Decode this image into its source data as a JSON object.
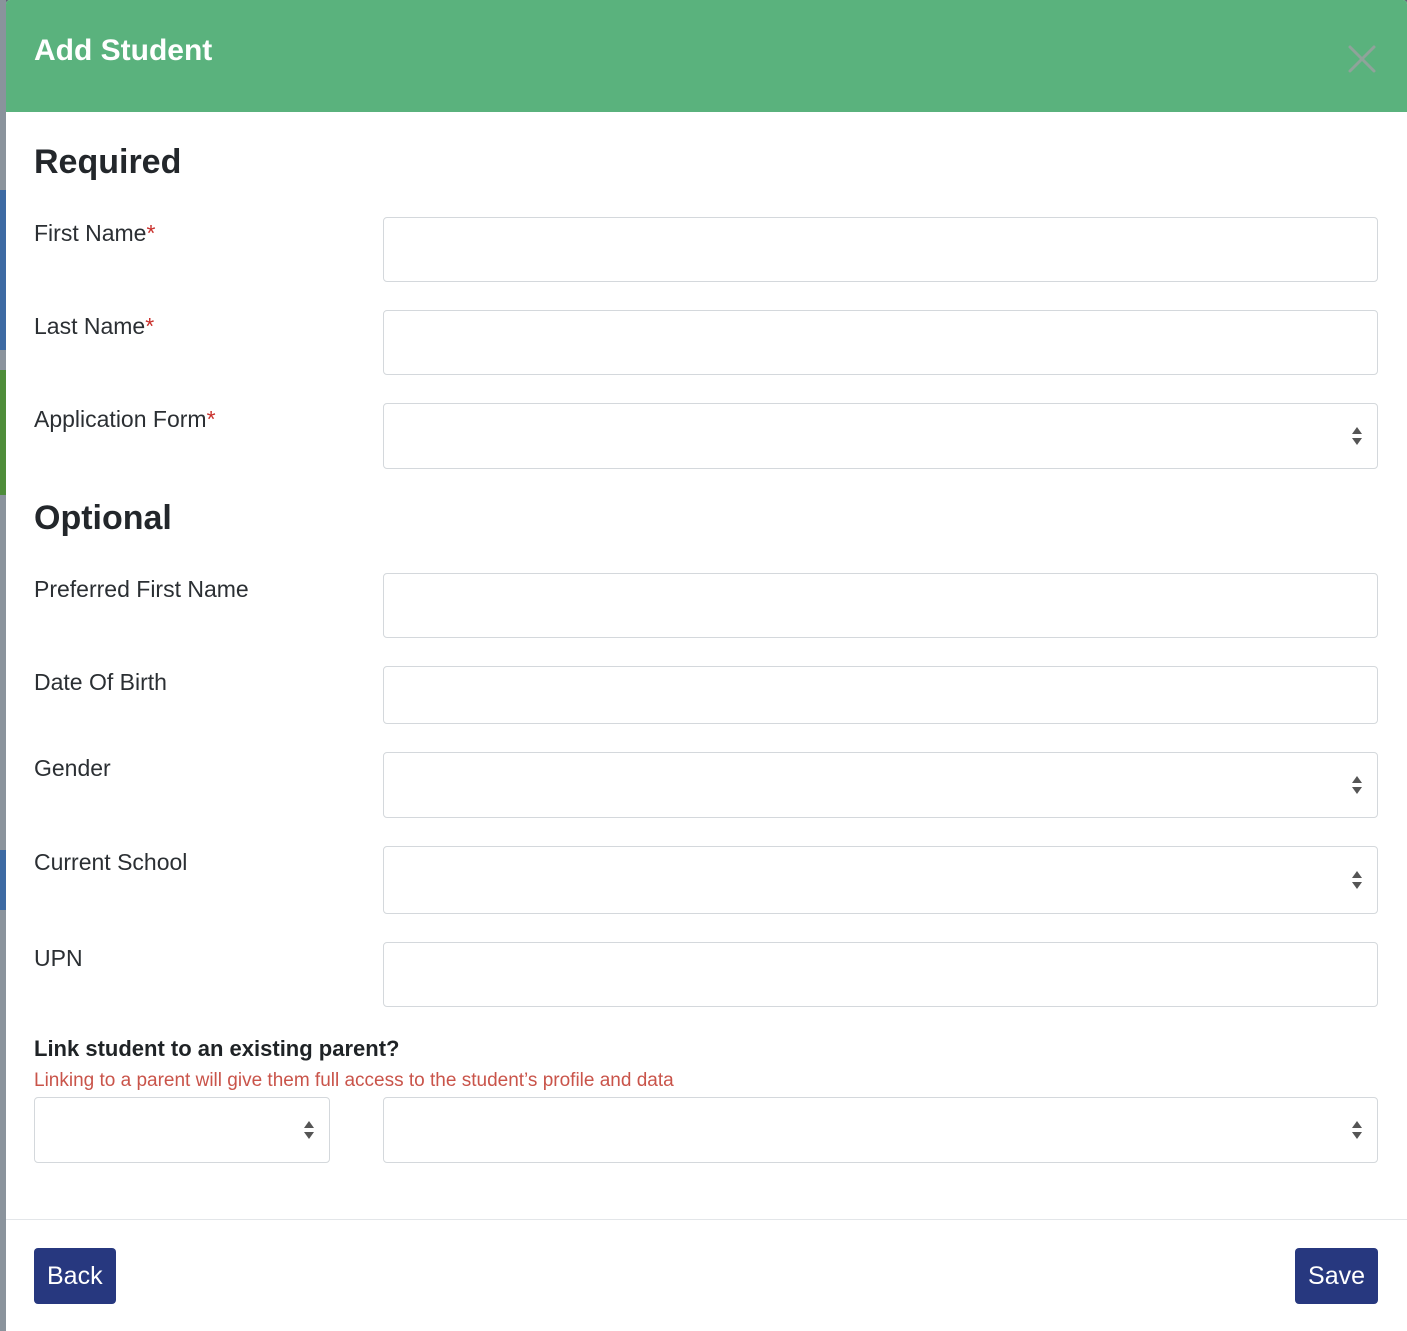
{
  "modal": {
    "title": "Add Student",
    "close_icon": "close-icon"
  },
  "required_section": {
    "title": "Required",
    "first_name_label": "First Name",
    "last_name_label": "Last Name",
    "application_form_label": "Application Form",
    "required_marker": "*"
  },
  "optional_section": {
    "title": "Optional",
    "preferred_first_name_label": "Preferred First Name",
    "date_of_birth_label": "Date Of Birth",
    "gender_label": "Gender",
    "current_school_label": "Current School",
    "upn_label": "UPN"
  },
  "link_parent": {
    "title": "Link student to an existing parent?",
    "note": "Linking to a parent will give them full access to the student’s profile and data"
  },
  "footer": {
    "back_label": "Back",
    "save_label": "Save"
  },
  "colors": {
    "header": "#5ab27d",
    "button": "#27387f",
    "required_marker": "#c9302c",
    "note": "#c9544a"
  }
}
